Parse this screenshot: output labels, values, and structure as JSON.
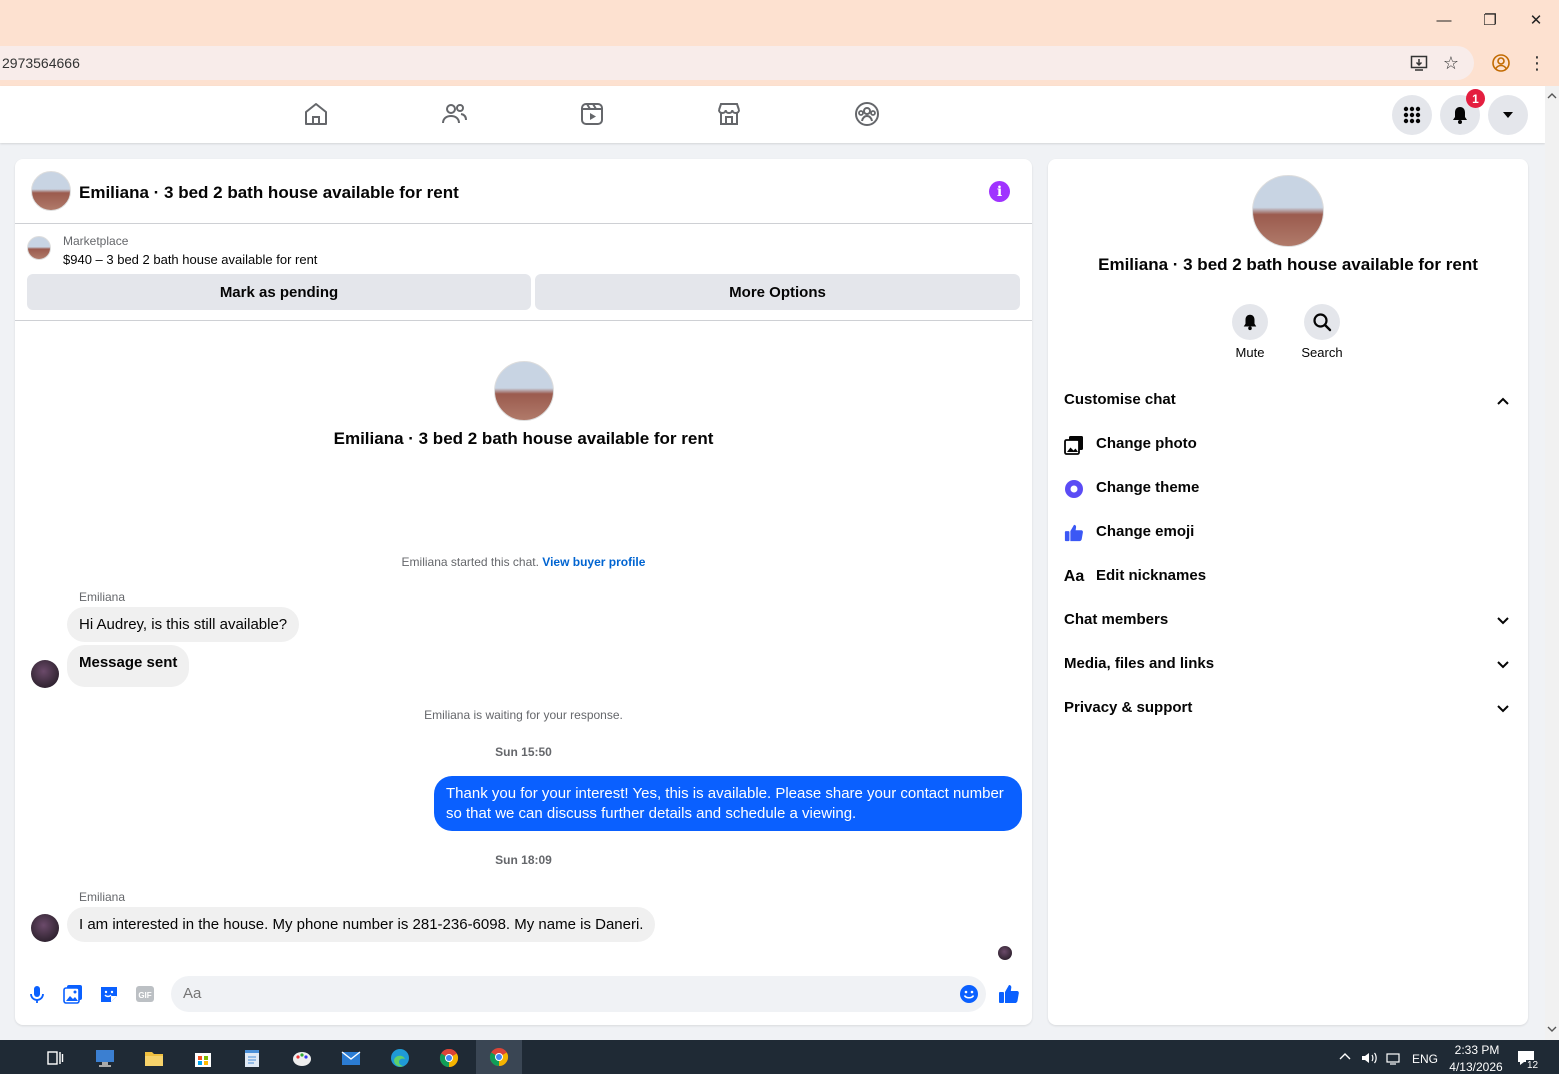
{
  "browser": {
    "url": "2973564666",
    "window_controls": {
      "minimize": "—",
      "restore": "❐",
      "close": "✕"
    }
  },
  "fb_header": {
    "nav_icons": [
      "home-icon",
      "friends-icon",
      "video-icon",
      "marketplace-icon",
      "groups-icon"
    ],
    "notification_count": "1"
  },
  "chat": {
    "title": "Emiliana · 3 bed 2 bath house available for rent",
    "marketplace_label": "Marketplace",
    "listing": "$940 – 3 bed 2 bath house available for rent",
    "mark_pending_label": "Mark as pending",
    "more_options_label": "More Options",
    "center_name": "Emiliana · 3 bed 2 bath house available for rent",
    "started_text": "Emiliana started this chat.",
    "view_buyer_profile": "View buyer profile",
    "messages": [
      {
        "sender": "Emiliana",
        "text": "Hi Audrey, is this still available?"
      },
      {
        "text": "Message sent"
      }
    ],
    "waiting_text": "Emiliana is waiting for your response.",
    "timestamp1": "Sun 15:50",
    "outgoing": "Thank you for your interest! Yes, this is available. Please share your contact number so that we can discuss further details and schedule a viewing.",
    "timestamp2": "Sun 18:09",
    "second_sender": "Emiliana",
    "last_message": "I am interested in the house. My phone number is 281-236-6098. My name is Daneri.",
    "composer_placeholder": "Aa"
  },
  "info_panel": {
    "name": "Emiliana · 3 bed 2 bath house available for rent",
    "mute_label": "Mute",
    "search_label": "Search",
    "customise_chat": "Customise chat",
    "change_photo": "Change photo",
    "change_theme": "Change theme",
    "change_emoji": "Change emoji",
    "edit_nicknames": "Edit nicknames",
    "edit_nicknames_icon_text": "Aa",
    "chat_members": "Chat members",
    "media_files_links": "Media, files and links",
    "privacy_support": "Privacy & support"
  },
  "taskbar": {
    "language": "ENG",
    "time": "2:33 PM",
    "date": "4/13/2026",
    "notification_count": "12"
  },
  "colors": {
    "accent_blue": "#0a60ff",
    "info_purple": "#a033ff",
    "badge_red": "#e41e3f",
    "titlebar_peach": "#fde1d0"
  }
}
